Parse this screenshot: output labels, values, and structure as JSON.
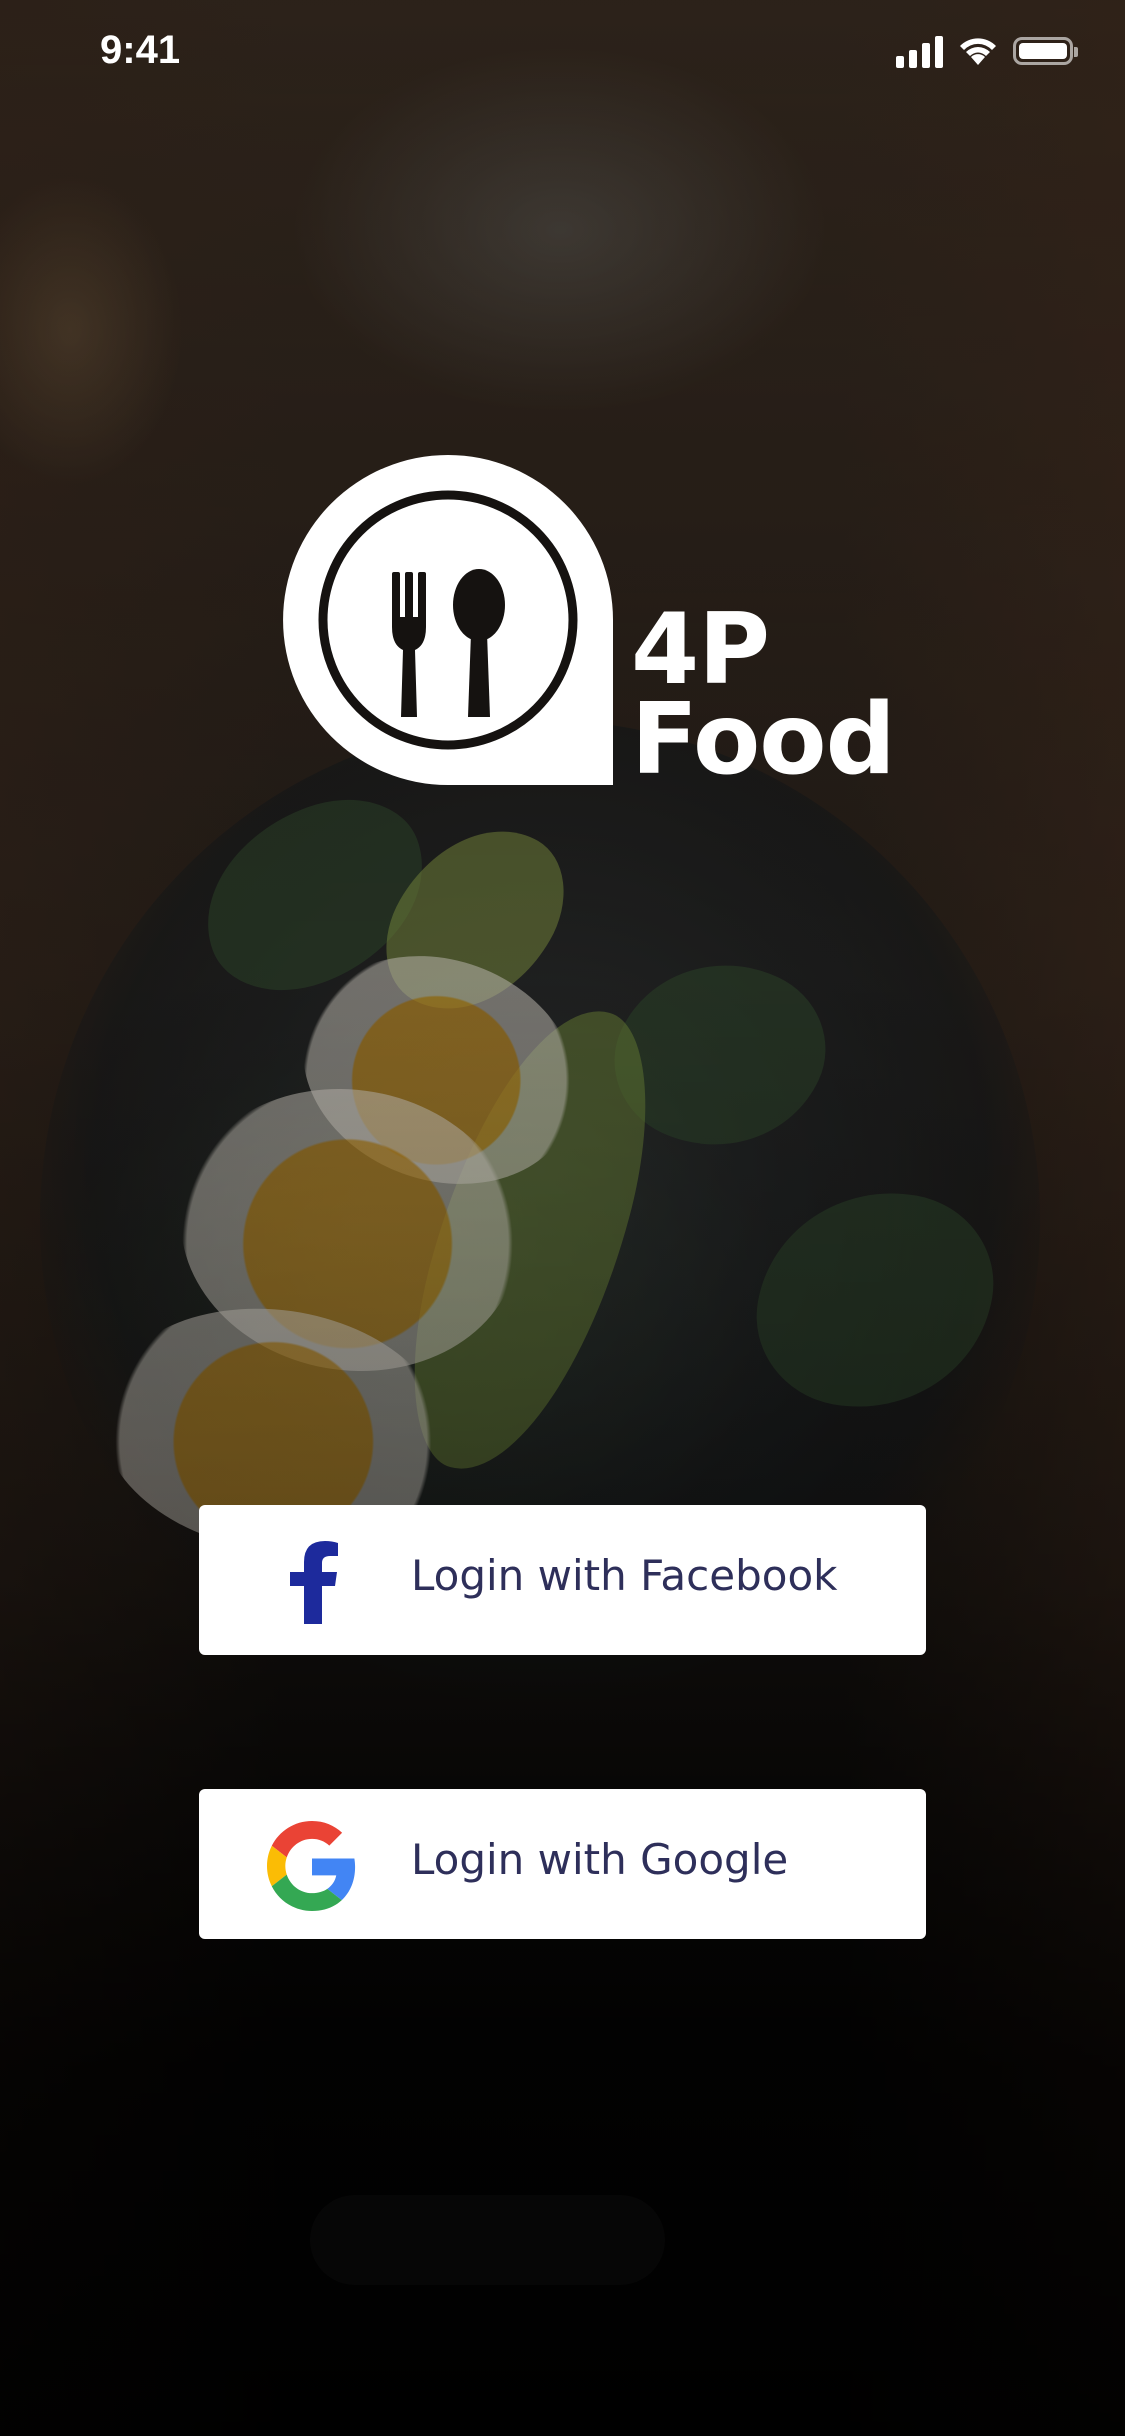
{
  "status_bar": {
    "time": "9:41",
    "icons": [
      "cellular-signal-icon",
      "wifi-icon",
      "battery-icon"
    ]
  },
  "logo": {
    "icon": "fork-and-spoon-icon",
    "line1": "4P",
    "line2": "Food"
  },
  "login": {
    "facebook": {
      "label": "Login with Facebook",
      "icon": "facebook-icon",
      "icon_color": "#1d2a9c"
    },
    "google": {
      "label": "Login with Google",
      "icon": "google-icon",
      "icon_colors": {
        "red": "#EA4335",
        "yellow": "#FBBC05",
        "green": "#34A853",
        "blue": "#4285F4"
      }
    },
    "button_background": "#ffffff",
    "label_color": "#2e2f5a"
  },
  "background": {
    "description_icon": "food-photo-background"
  }
}
